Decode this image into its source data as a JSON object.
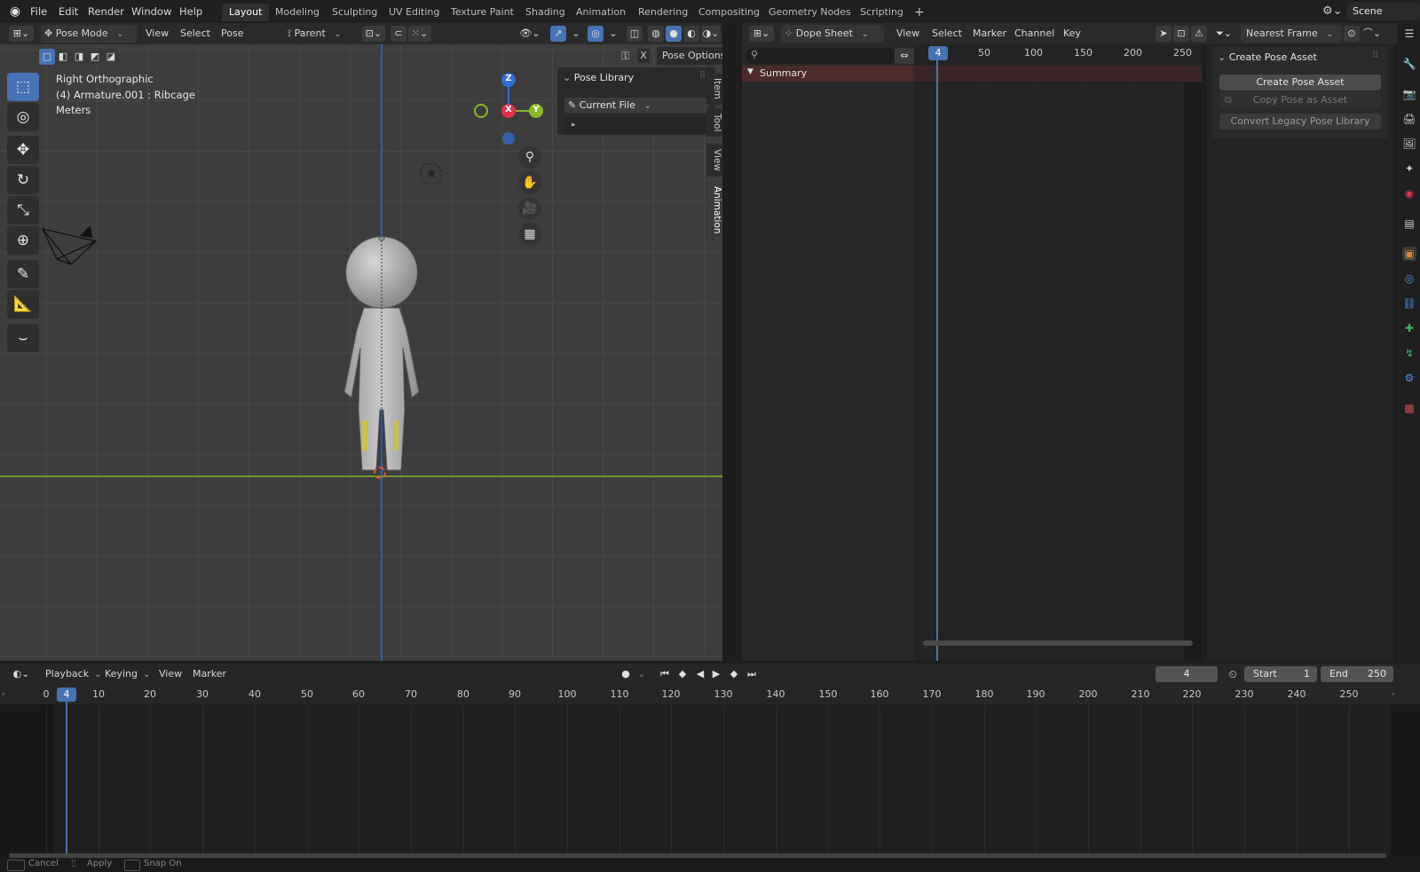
{
  "topbar": {
    "menus": [
      "File",
      "Edit",
      "Render",
      "Window",
      "Help"
    ],
    "workspaces": [
      "Layout",
      "Modeling",
      "Sculpting",
      "UV Editing",
      "Texture Paint",
      "Shading",
      "Animation",
      "Rendering",
      "Compositing",
      "Geometry Nodes",
      "Scripting"
    ],
    "active_workspace": "Layout",
    "add_workspace": "+",
    "scene": "Scene"
  },
  "viewport_header": {
    "mode": "Pose Mode",
    "menus": [
      "View",
      "Select",
      "Pose"
    ],
    "pivot": "Parent",
    "pose_options": "Pose Options",
    "x_label": "X"
  },
  "viewport": {
    "view_name": "Right Orthographic",
    "object_info": "(4) Armature.001 : Ribcage",
    "units": "Meters",
    "gizmo": {
      "z": "Z",
      "x": "X",
      "y": "Y"
    },
    "tabs": [
      "Item",
      "Tool",
      "View",
      "Animation"
    ],
    "active_tab": "Animation"
  },
  "pose_library_panel": {
    "title": "Pose Library",
    "library": "Current File",
    "expander": "▸"
  },
  "dopesheet_header": {
    "editor": "Dope Sheet",
    "menus": [
      "View",
      "Select",
      "Marker",
      "Channel",
      "Key"
    ],
    "snapping": "Nearest Frame"
  },
  "dopesheet": {
    "current_frame": "4",
    "ticks": [
      "50",
      "100",
      "150",
      "200",
      "250"
    ],
    "channel": "Summary"
  },
  "create_pose_panel": {
    "title": "Create Pose Asset",
    "buttons": [
      "Create Pose Asset",
      "Copy Pose as Asset",
      "Convert Legacy Pose Library"
    ]
  },
  "timeline_header": {
    "menus": [
      "Playback",
      "Keying",
      "View",
      "Marker"
    ],
    "current_frame": "4",
    "start_label": "Start",
    "start_value": "1",
    "end_label": "End",
    "end_value": "250"
  },
  "timeline": {
    "current_frame": "4",
    "ticks": [
      "0",
      "10",
      "20",
      "30",
      "40",
      "50",
      "60",
      "70",
      "80",
      "90",
      "100",
      "110",
      "120",
      "130",
      "140",
      "150",
      "160",
      "170",
      "180",
      "190",
      "200",
      "210",
      "220",
      "230",
      "240",
      "250"
    ]
  },
  "statusbar": {
    "items": [
      "Cancel",
      "Apply",
      "Snap On"
    ]
  },
  "colors": {
    "accent": "#4772b3",
    "summary_row": "#4b2a2a",
    "axis_x": "#e3324b",
    "axis_y": "#8ab827",
    "axis_z": "#2d6fd6"
  }
}
